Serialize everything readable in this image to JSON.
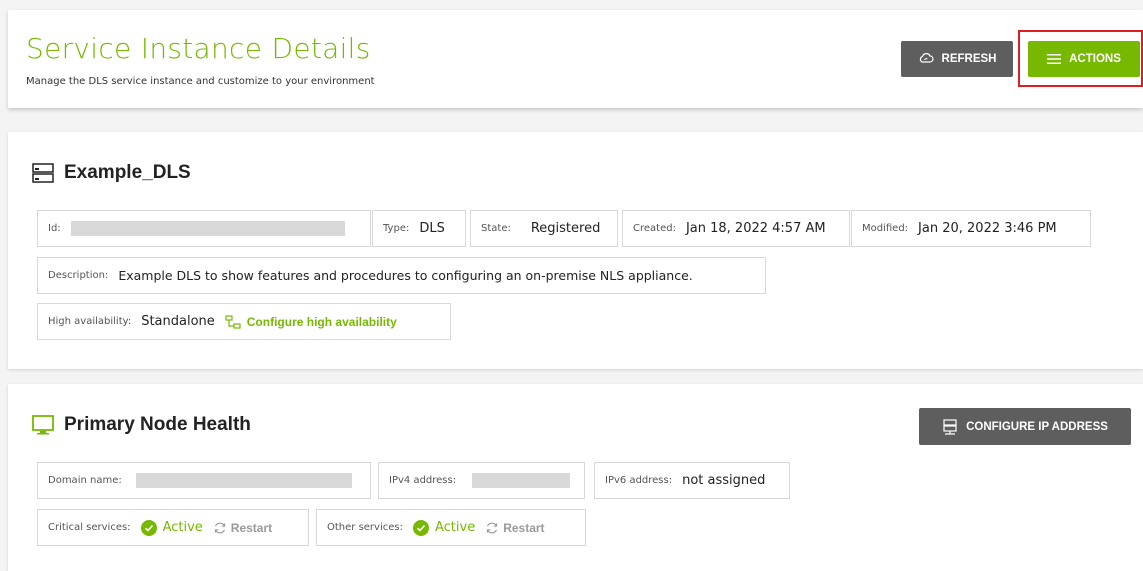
{
  "header": {
    "title": "Service Instance Details",
    "subtitle": "Manage the DLS service instance and customize to your environment",
    "refresh_label": "REFRESH",
    "actions_label": "ACTIONS"
  },
  "instance": {
    "name": "Example_DLS",
    "id_label": "Id:",
    "type_label": "Type:",
    "type_value": "DLS",
    "state_label": "State:",
    "state_value": "Registered",
    "created_label": "Created:",
    "created_value": "Jan 18, 2022 4:57 AM",
    "modified_label": "Modified:",
    "modified_value": "Jan 20, 2022 3:46 PM",
    "description_label": "Description:",
    "description_value": "Example DLS to show features and procedures to configuring an on-premise NLS appliance.",
    "ha_label": "High availability:",
    "ha_value": "Standalone",
    "ha_link": "Configure high availability"
  },
  "node": {
    "title": "Primary Node Health",
    "configure_ip_label": "CONFIGURE IP ADDRESS",
    "domain_label": "Domain name:",
    "ipv4_label": "IPv4 address:",
    "ipv6_label": "IPv6 address:",
    "ipv6_value": "not assigned",
    "critical_label": "Critical services:",
    "other_label": "Other services:",
    "active_label": "Active",
    "restart_label": "Restart"
  },
  "colors": {
    "accent": "#76b900",
    "dark_button": "#5e5e5e",
    "highlight": "#e01b24"
  }
}
